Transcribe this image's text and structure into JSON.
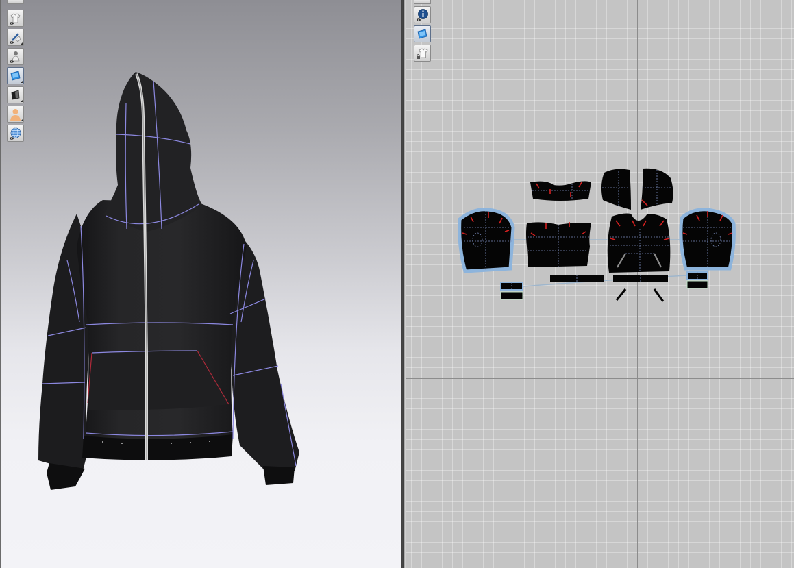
{
  "viewport3d": {
    "background_top": "#8e8e94",
    "background_bottom": "#f3f3f7",
    "toolbar": [
      {
        "icon": "garment-visibility-icon",
        "active": false
      },
      {
        "icon": "paint-brush-visibility-icon",
        "active": false
      },
      {
        "icon": "avatar-silhouette-visibility-icon",
        "active": false
      },
      {
        "icon": "fabric-texture-icon",
        "active": true
      },
      {
        "icon": "solid-shading-icon",
        "active": false
      },
      {
        "icon": "avatar-skin-icon",
        "active": false
      },
      {
        "icon": "world-grid-icon",
        "active": false
      }
    ],
    "garment": {
      "type": "zip-up hoodie",
      "fabric_color": "#232325",
      "seam_color": "#8c88e0",
      "zipper_color": "#d6d6d6"
    }
  },
  "viewport2d": {
    "background": "#c4c4c4",
    "grid_color": "#dadada",
    "axis_color": "#8c8c8c",
    "toolbar": [
      {
        "icon": "info-visibility-icon",
        "active": false
      },
      {
        "icon": "texture-2d-icon",
        "active": true
      },
      {
        "icon": "lock-garment-icon",
        "active": false
      }
    ],
    "pattern_color": "#050505",
    "selection_color": "#8db4dc",
    "notch_color": "#d42020"
  }
}
